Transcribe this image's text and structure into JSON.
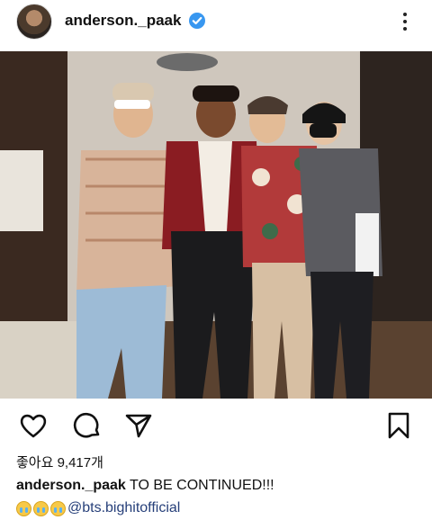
{
  "post": {
    "username": "anderson._paak",
    "verified_icon": "verified-badge-icon",
    "more_icon": "more-options-icon",
    "photo_alt": "",
    "actions": {
      "like_icon": "heart-icon",
      "comment_icon": "comment-icon",
      "share_icon": "send-icon",
      "save_icon": "bookmark-icon"
    },
    "likes_text": "좋아요 9,417개",
    "caption": {
      "username": "anderson._paak",
      "text": "TO BE CONTINUED!!!"
    },
    "mention_line": {
      "emoji_name": "crying-face-icon",
      "emoji_count": 3,
      "mention": "@bts.bighitofficial"
    }
  },
  "colors": {
    "verified": "#3897f0",
    "mention": "#27407a",
    "text": "#111111"
  }
}
